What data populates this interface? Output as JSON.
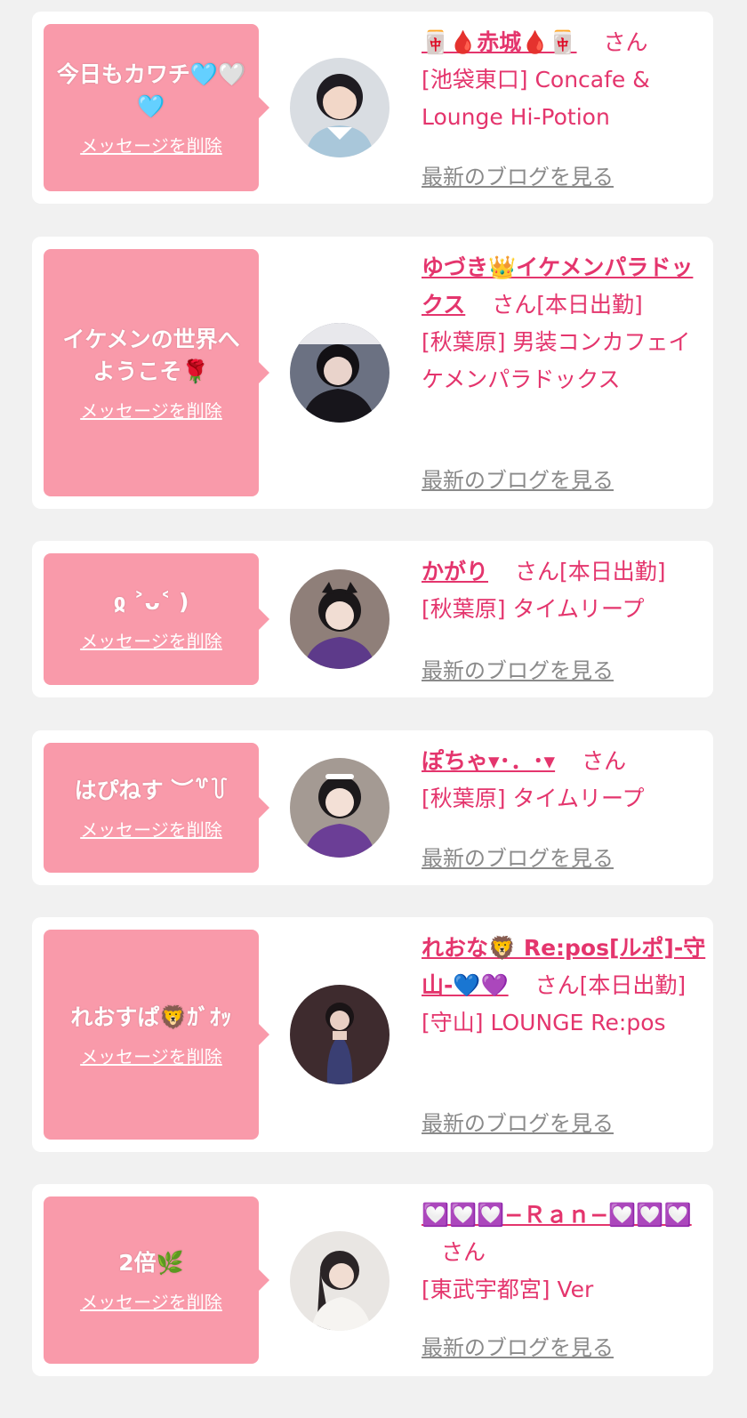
{
  "delete_label": "メッセージを削除",
  "blog_label": "最新のブログを見る",
  "san_label": "さん",
  "items": [
    {
      "message": "今日もカワチ🩵🤍🩵",
      "name": "🀄🩸赤城🩸🀄",
      "working": "",
      "shop": "[池袋東口] Concafe & Lounge Hi-Potion"
    },
    {
      "message": "イケメンの世界へようこそ🌹",
      "name": "ゆづき👑イケメンパラドックス",
      "working": "[本日出勤]",
      "shop": "[秋葉原] 男装コンカフェイケメンパラドックス"
    },
    {
      "message": "ჲ ˃ᴗ˂ )",
      "name": "かがり",
      "working": "[本日出勤]",
      "shop": "[秋葉原] タイムリープ"
    },
    {
      "message": "はぴねす ︶꒷꒦",
      "name": "ぽちゃ▾･．･▾",
      "working": "",
      "shop": "[秋葉原] タイムリープ"
    },
    {
      "message": "れおすぱ🦁ｶﾞｵｯ",
      "name": "れおな🦁 Re:pos[ルポ]-守山-💙💜",
      "working": "[本日出勤]",
      "shop": "[守山] LOUNGE Re:pos"
    },
    {
      "message": "2倍🌿",
      "name": "💟💟💟−Ｒａｎ−💟💟💟",
      "working": "",
      "shop": "[東武宇都宮] Ver"
    }
  ],
  "colors": {
    "background": "#f1f1f1",
    "bubble": "#f99aaa",
    "accent": "#e4356d",
    "blog_link": "#8a8a8a"
  }
}
